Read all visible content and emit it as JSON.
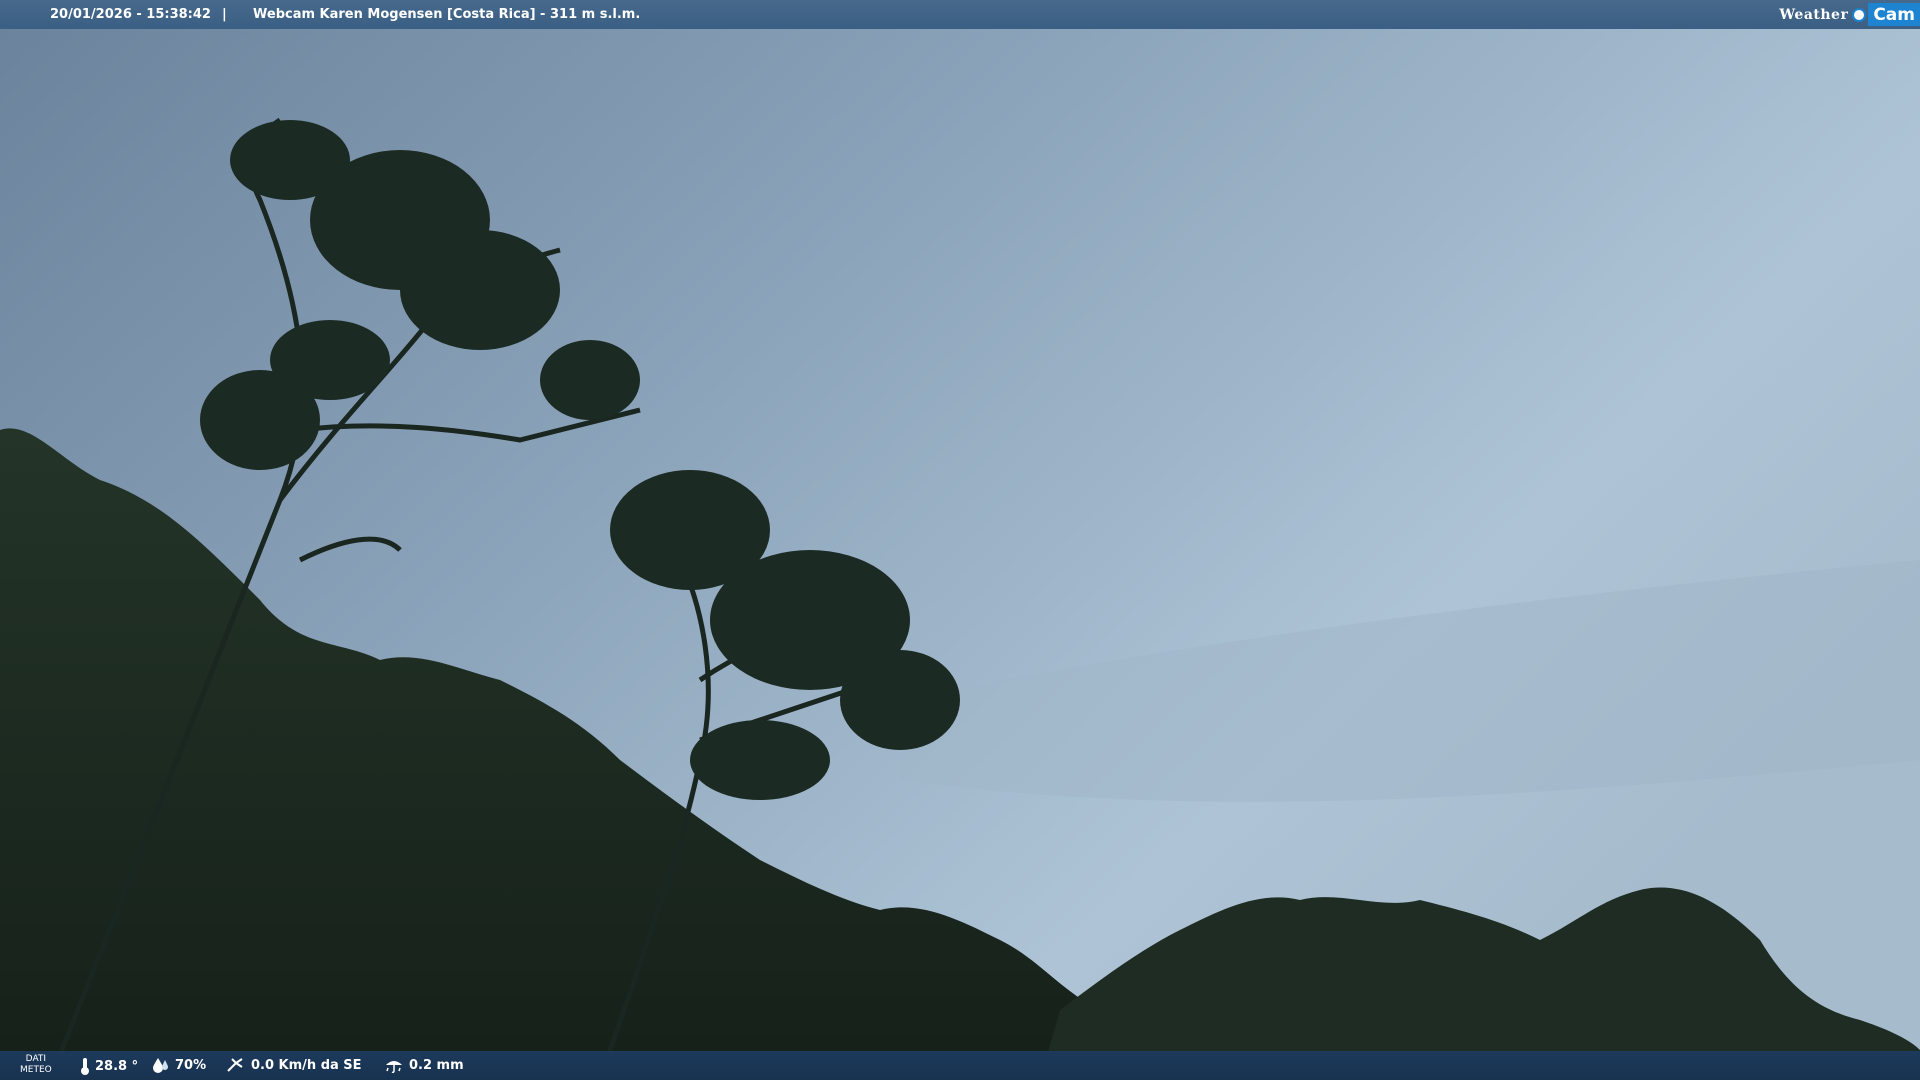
{
  "header": {
    "timestamp": "20/01/2026 - 15:38:42",
    "separator": "|",
    "title": "Webcam Karen Mogensen [Costa Rica] - 311 m s.l.m.",
    "logo_weather": "Weather",
    "logo_cam": "Cam"
  },
  "footer": {
    "dati_line1": "DATI",
    "dati_line2": "METEO",
    "temperature": "28.8 °",
    "humidity": "70%",
    "wind": "0.0 Km/h da SE",
    "rain": "0.2 mm",
    "icons": [
      "thermometer-icon",
      "humidity-icon",
      "wind-icon",
      "rain-icon"
    ]
  },
  "colors": {
    "sky_light": "#b0c6d8",
    "sky_dark": "#6f88a0",
    "foliage": "#1c2a22",
    "topbar": "#40648a",
    "bottombar": "#1b3656",
    "logo_accent": "#1e84d2"
  }
}
